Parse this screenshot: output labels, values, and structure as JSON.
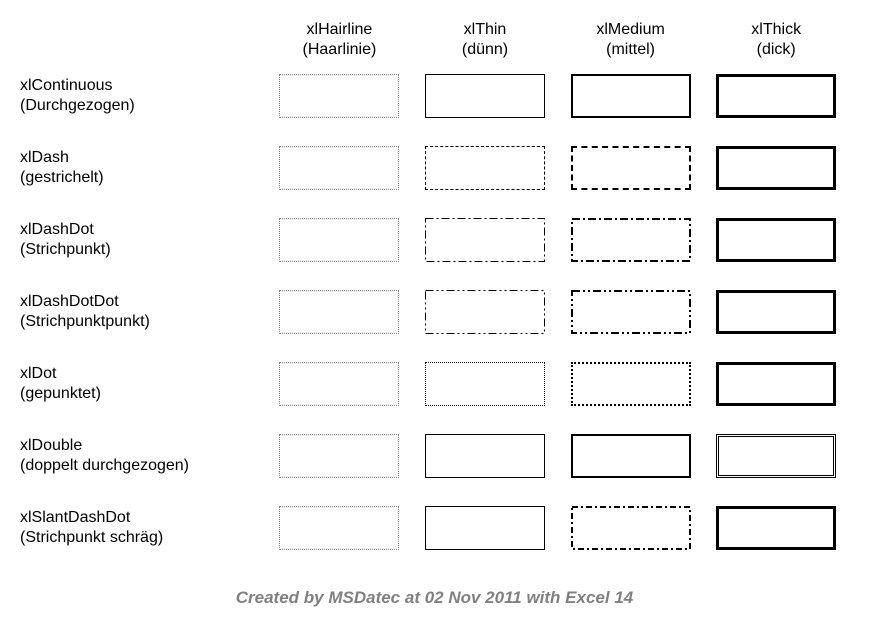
{
  "columns": [
    {
      "code": "xlHairline",
      "de": "(Haarlinie)",
      "cls": "w-hair"
    },
    {
      "code": "xlThin",
      "de": "(dünn)",
      "cls": "w-thin"
    },
    {
      "code": "xlMedium",
      "de": "(mittel)",
      "cls": "w-medium"
    },
    {
      "code": "xlThick",
      "de": "(dick)",
      "cls": "w-thick"
    }
  ],
  "rows": [
    {
      "code": "xlContinuous",
      "de": "(Durchgezogen)",
      "cls": "s-cont"
    },
    {
      "code": "xlDash",
      "de": "(gestrichelt)",
      "cls": "s-dash"
    },
    {
      "code": "xlDashDot",
      "de": "(Strichpunkt)",
      "cls": "s-dashdot"
    },
    {
      "code": "xlDashDotDot",
      "de": "(Strichpunktpunkt)",
      "cls": "s-dashdotdot"
    },
    {
      "code": "xlDot",
      "de": "(gepunktet)",
      "cls": "s-dot"
    },
    {
      "code": "xlDouble",
      "de": "(doppelt durchgezogen)",
      "cls": "s-double"
    },
    {
      "code": "xlSlantDashDot",
      "de": "(Strichpunkt schräg)",
      "cls": "s-slant"
    }
  ],
  "footer": "Created by MSDatec at 02 Nov 2011 with Excel 14"
}
